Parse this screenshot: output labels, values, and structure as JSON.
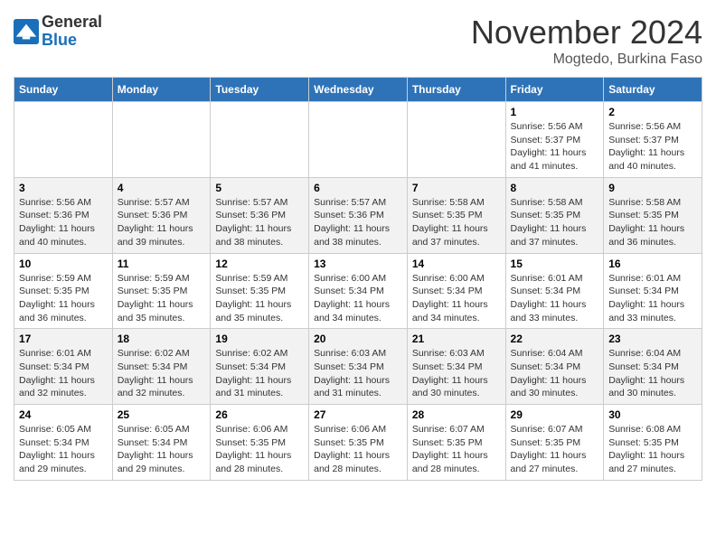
{
  "header": {
    "logo_line1": "General",
    "logo_line2": "Blue",
    "month": "November 2024",
    "location": "Mogtedo, Burkina Faso"
  },
  "days_of_week": [
    "Sunday",
    "Monday",
    "Tuesday",
    "Wednesday",
    "Thursday",
    "Friday",
    "Saturday"
  ],
  "weeks": [
    {
      "id": "week1",
      "days": [
        {
          "date": "",
          "info": ""
        },
        {
          "date": "",
          "info": ""
        },
        {
          "date": "",
          "info": ""
        },
        {
          "date": "",
          "info": ""
        },
        {
          "date": "",
          "info": ""
        },
        {
          "date": "1",
          "info": "Sunrise: 5:56 AM\nSunset: 5:37 PM\nDaylight: 11 hours and 41 minutes."
        },
        {
          "date": "2",
          "info": "Sunrise: 5:56 AM\nSunset: 5:37 PM\nDaylight: 11 hours and 40 minutes."
        }
      ]
    },
    {
      "id": "week2",
      "days": [
        {
          "date": "3",
          "info": "Sunrise: 5:56 AM\nSunset: 5:36 PM\nDaylight: 11 hours and 40 minutes."
        },
        {
          "date": "4",
          "info": "Sunrise: 5:57 AM\nSunset: 5:36 PM\nDaylight: 11 hours and 39 minutes."
        },
        {
          "date": "5",
          "info": "Sunrise: 5:57 AM\nSunset: 5:36 PM\nDaylight: 11 hours and 38 minutes."
        },
        {
          "date": "6",
          "info": "Sunrise: 5:57 AM\nSunset: 5:36 PM\nDaylight: 11 hours and 38 minutes."
        },
        {
          "date": "7",
          "info": "Sunrise: 5:58 AM\nSunset: 5:35 PM\nDaylight: 11 hours and 37 minutes."
        },
        {
          "date": "8",
          "info": "Sunrise: 5:58 AM\nSunset: 5:35 PM\nDaylight: 11 hours and 37 minutes."
        },
        {
          "date": "9",
          "info": "Sunrise: 5:58 AM\nSunset: 5:35 PM\nDaylight: 11 hours and 36 minutes."
        }
      ]
    },
    {
      "id": "week3",
      "days": [
        {
          "date": "10",
          "info": "Sunrise: 5:59 AM\nSunset: 5:35 PM\nDaylight: 11 hours and 36 minutes."
        },
        {
          "date": "11",
          "info": "Sunrise: 5:59 AM\nSunset: 5:35 PM\nDaylight: 11 hours and 35 minutes."
        },
        {
          "date": "12",
          "info": "Sunrise: 5:59 AM\nSunset: 5:35 PM\nDaylight: 11 hours and 35 minutes."
        },
        {
          "date": "13",
          "info": "Sunrise: 6:00 AM\nSunset: 5:34 PM\nDaylight: 11 hours and 34 minutes."
        },
        {
          "date": "14",
          "info": "Sunrise: 6:00 AM\nSunset: 5:34 PM\nDaylight: 11 hours and 34 minutes."
        },
        {
          "date": "15",
          "info": "Sunrise: 6:01 AM\nSunset: 5:34 PM\nDaylight: 11 hours and 33 minutes."
        },
        {
          "date": "16",
          "info": "Sunrise: 6:01 AM\nSunset: 5:34 PM\nDaylight: 11 hours and 33 minutes."
        }
      ]
    },
    {
      "id": "week4",
      "days": [
        {
          "date": "17",
          "info": "Sunrise: 6:01 AM\nSunset: 5:34 PM\nDaylight: 11 hours and 32 minutes."
        },
        {
          "date": "18",
          "info": "Sunrise: 6:02 AM\nSunset: 5:34 PM\nDaylight: 11 hours and 32 minutes."
        },
        {
          "date": "19",
          "info": "Sunrise: 6:02 AM\nSunset: 5:34 PM\nDaylight: 11 hours and 31 minutes."
        },
        {
          "date": "20",
          "info": "Sunrise: 6:03 AM\nSunset: 5:34 PM\nDaylight: 11 hours and 31 minutes."
        },
        {
          "date": "21",
          "info": "Sunrise: 6:03 AM\nSunset: 5:34 PM\nDaylight: 11 hours and 30 minutes."
        },
        {
          "date": "22",
          "info": "Sunrise: 6:04 AM\nSunset: 5:34 PM\nDaylight: 11 hours and 30 minutes."
        },
        {
          "date": "23",
          "info": "Sunrise: 6:04 AM\nSunset: 5:34 PM\nDaylight: 11 hours and 30 minutes."
        }
      ]
    },
    {
      "id": "week5",
      "days": [
        {
          "date": "24",
          "info": "Sunrise: 6:05 AM\nSunset: 5:34 PM\nDaylight: 11 hours and 29 minutes."
        },
        {
          "date": "25",
          "info": "Sunrise: 6:05 AM\nSunset: 5:34 PM\nDaylight: 11 hours and 29 minutes."
        },
        {
          "date": "26",
          "info": "Sunrise: 6:06 AM\nSunset: 5:35 PM\nDaylight: 11 hours and 28 minutes."
        },
        {
          "date": "27",
          "info": "Sunrise: 6:06 AM\nSunset: 5:35 PM\nDaylight: 11 hours and 28 minutes."
        },
        {
          "date": "28",
          "info": "Sunrise: 6:07 AM\nSunset: 5:35 PM\nDaylight: 11 hours and 28 minutes."
        },
        {
          "date": "29",
          "info": "Sunrise: 6:07 AM\nSunset: 5:35 PM\nDaylight: 11 hours and 27 minutes."
        },
        {
          "date": "30",
          "info": "Sunrise: 6:08 AM\nSunset: 5:35 PM\nDaylight: 11 hours and 27 minutes."
        }
      ]
    }
  ]
}
